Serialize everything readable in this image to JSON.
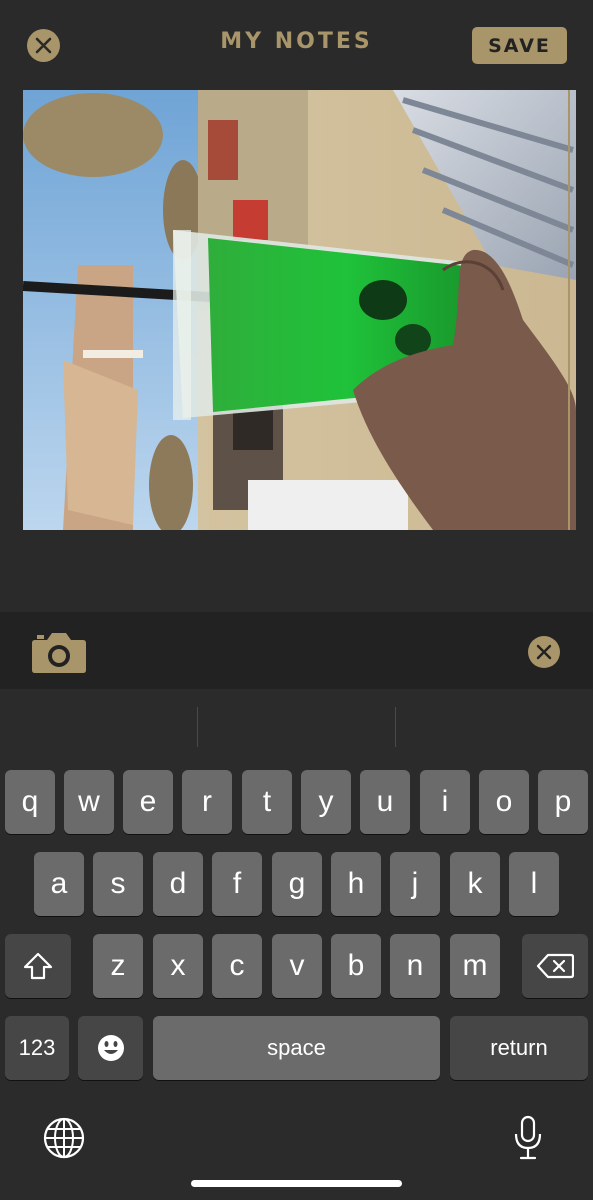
{
  "header": {
    "title": "MY NOTES",
    "save_label": "SAVE"
  },
  "colors": {
    "accent": "#a89569",
    "background": "#2a2a2a",
    "key": "#6b6b6b",
    "key_dark": "#464646"
  },
  "photo": {
    "subject": "green drink in glass held on beach"
  },
  "toolbar": {
    "camera_icon": "camera-icon",
    "clear_icon": "close-icon"
  },
  "keyboard": {
    "row1": [
      "q",
      "w",
      "e",
      "r",
      "t",
      "y",
      "u",
      "i",
      "o",
      "p"
    ],
    "row2": [
      "a",
      "s",
      "d",
      "f",
      "g",
      "h",
      "j",
      "k",
      "l"
    ],
    "row3": [
      "z",
      "x",
      "c",
      "v",
      "b",
      "n",
      "m"
    ],
    "numbers_label": "123",
    "space_label": "space",
    "return_label": "return"
  }
}
